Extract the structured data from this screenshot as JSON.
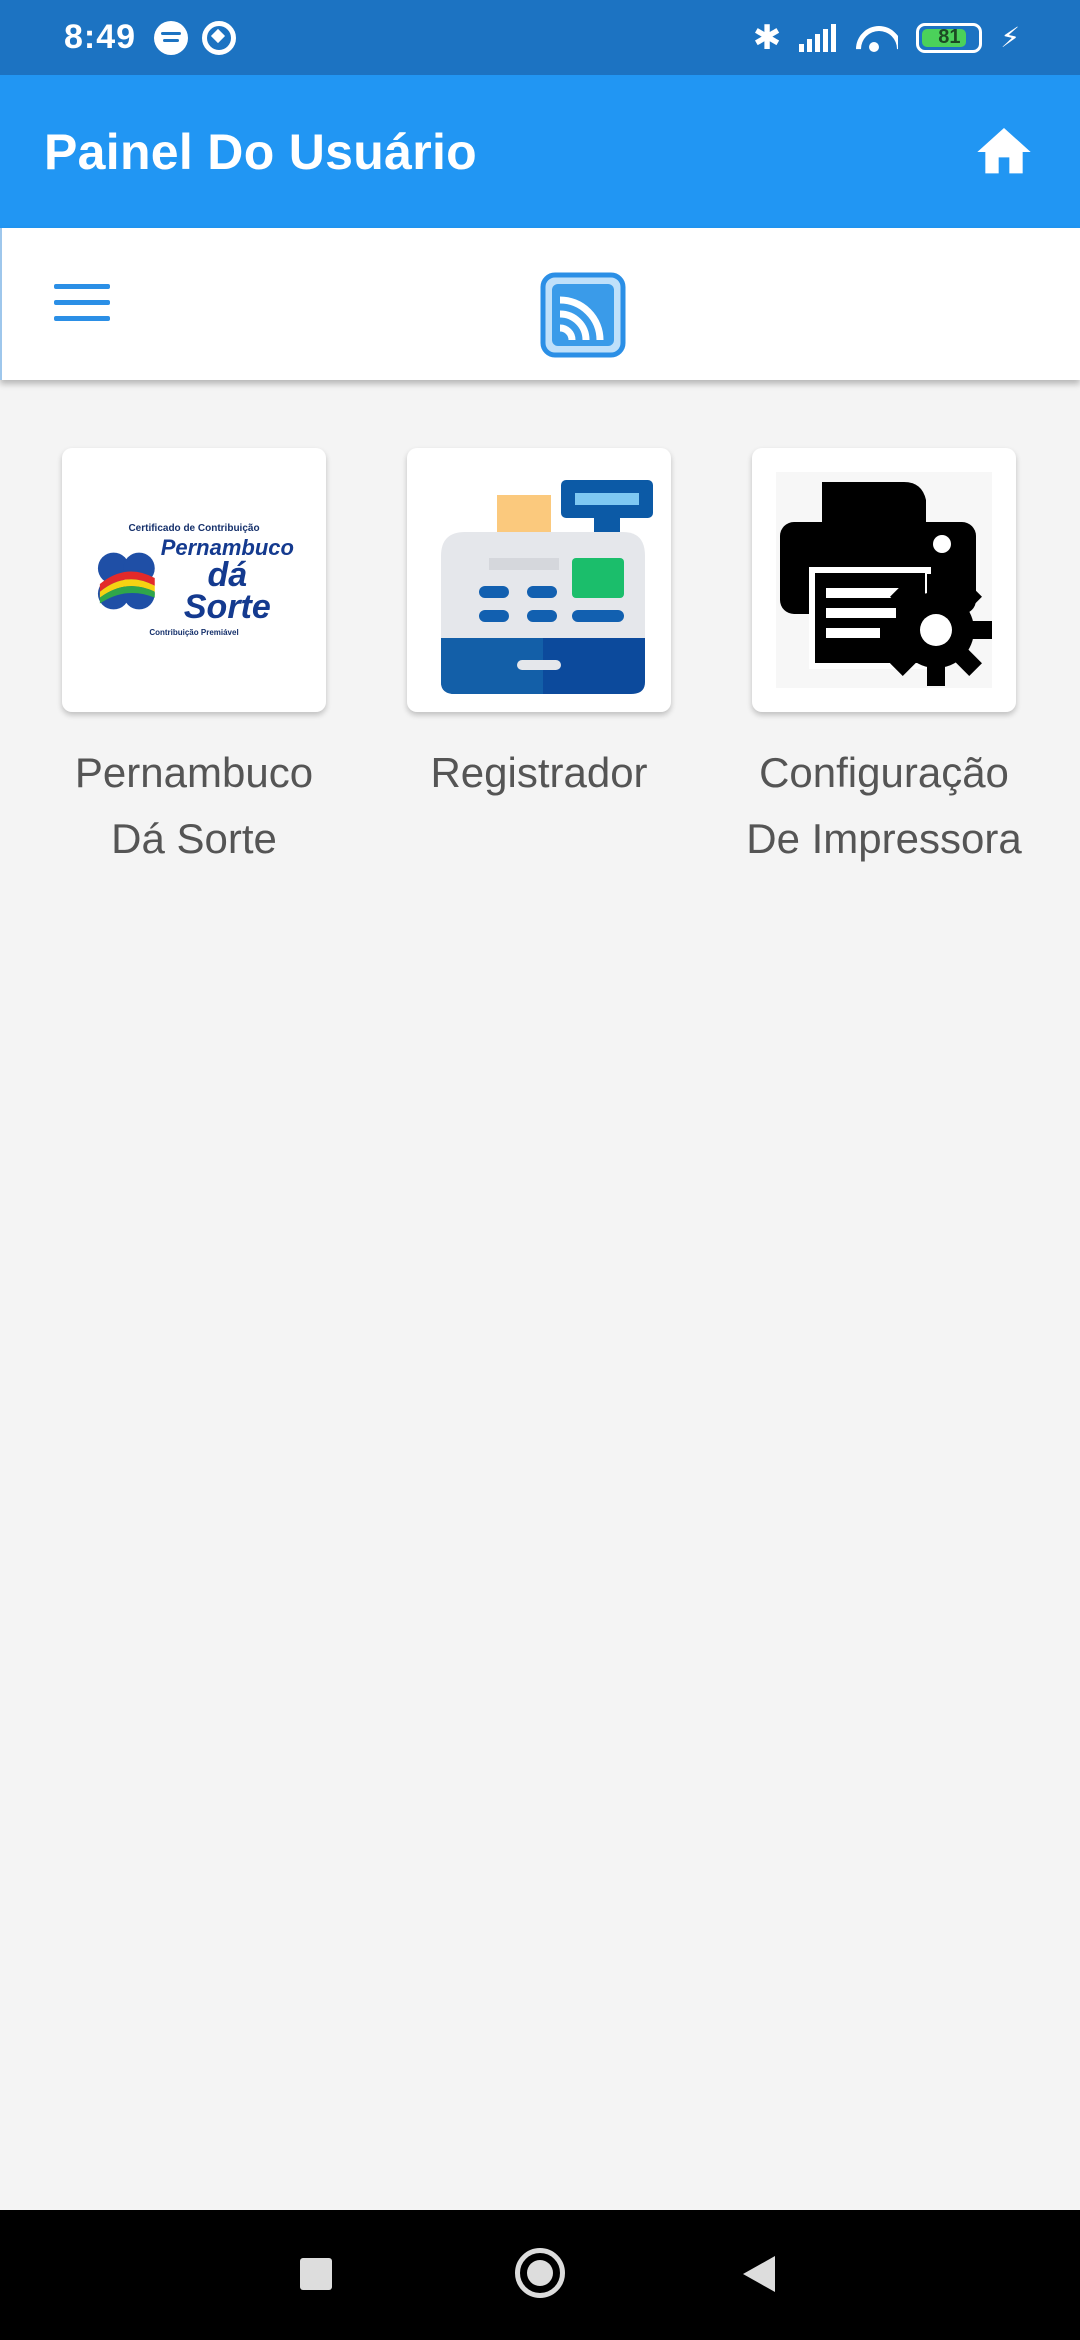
{
  "status_bar": {
    "time": "8:49",
    "battery_level": "81",
    "battery_fraction": 0.81
  },
  "app_bar": {
    "title": "Painel Do Usuário"
  },
  "colors": {
    "status_bar": "#1c73c2",
    "app_bar": "#2196f3",
    "background": "#f4f4f4",
    "accent": "#2b8fe6"
  },
  "tiles": [
    {
      "label": "Pernambuco Dá Sorte",
      "icon": "pernambuco-da-sorte-logo",
      "logo_text": {
        "top": "Certificado de Contribuição",
        "line1": "Pernambuco",
        "line2": "dá Sorte",
        "bottom": "Contribuição Premiável"
      }
    },
    {
      "label": "Registrador",
      "icon": "cash-register-icon"
    },
    {
      "label": "Configuração De Impressora",
      "icon": "printer-settings-icon"
    }
  ]
}
